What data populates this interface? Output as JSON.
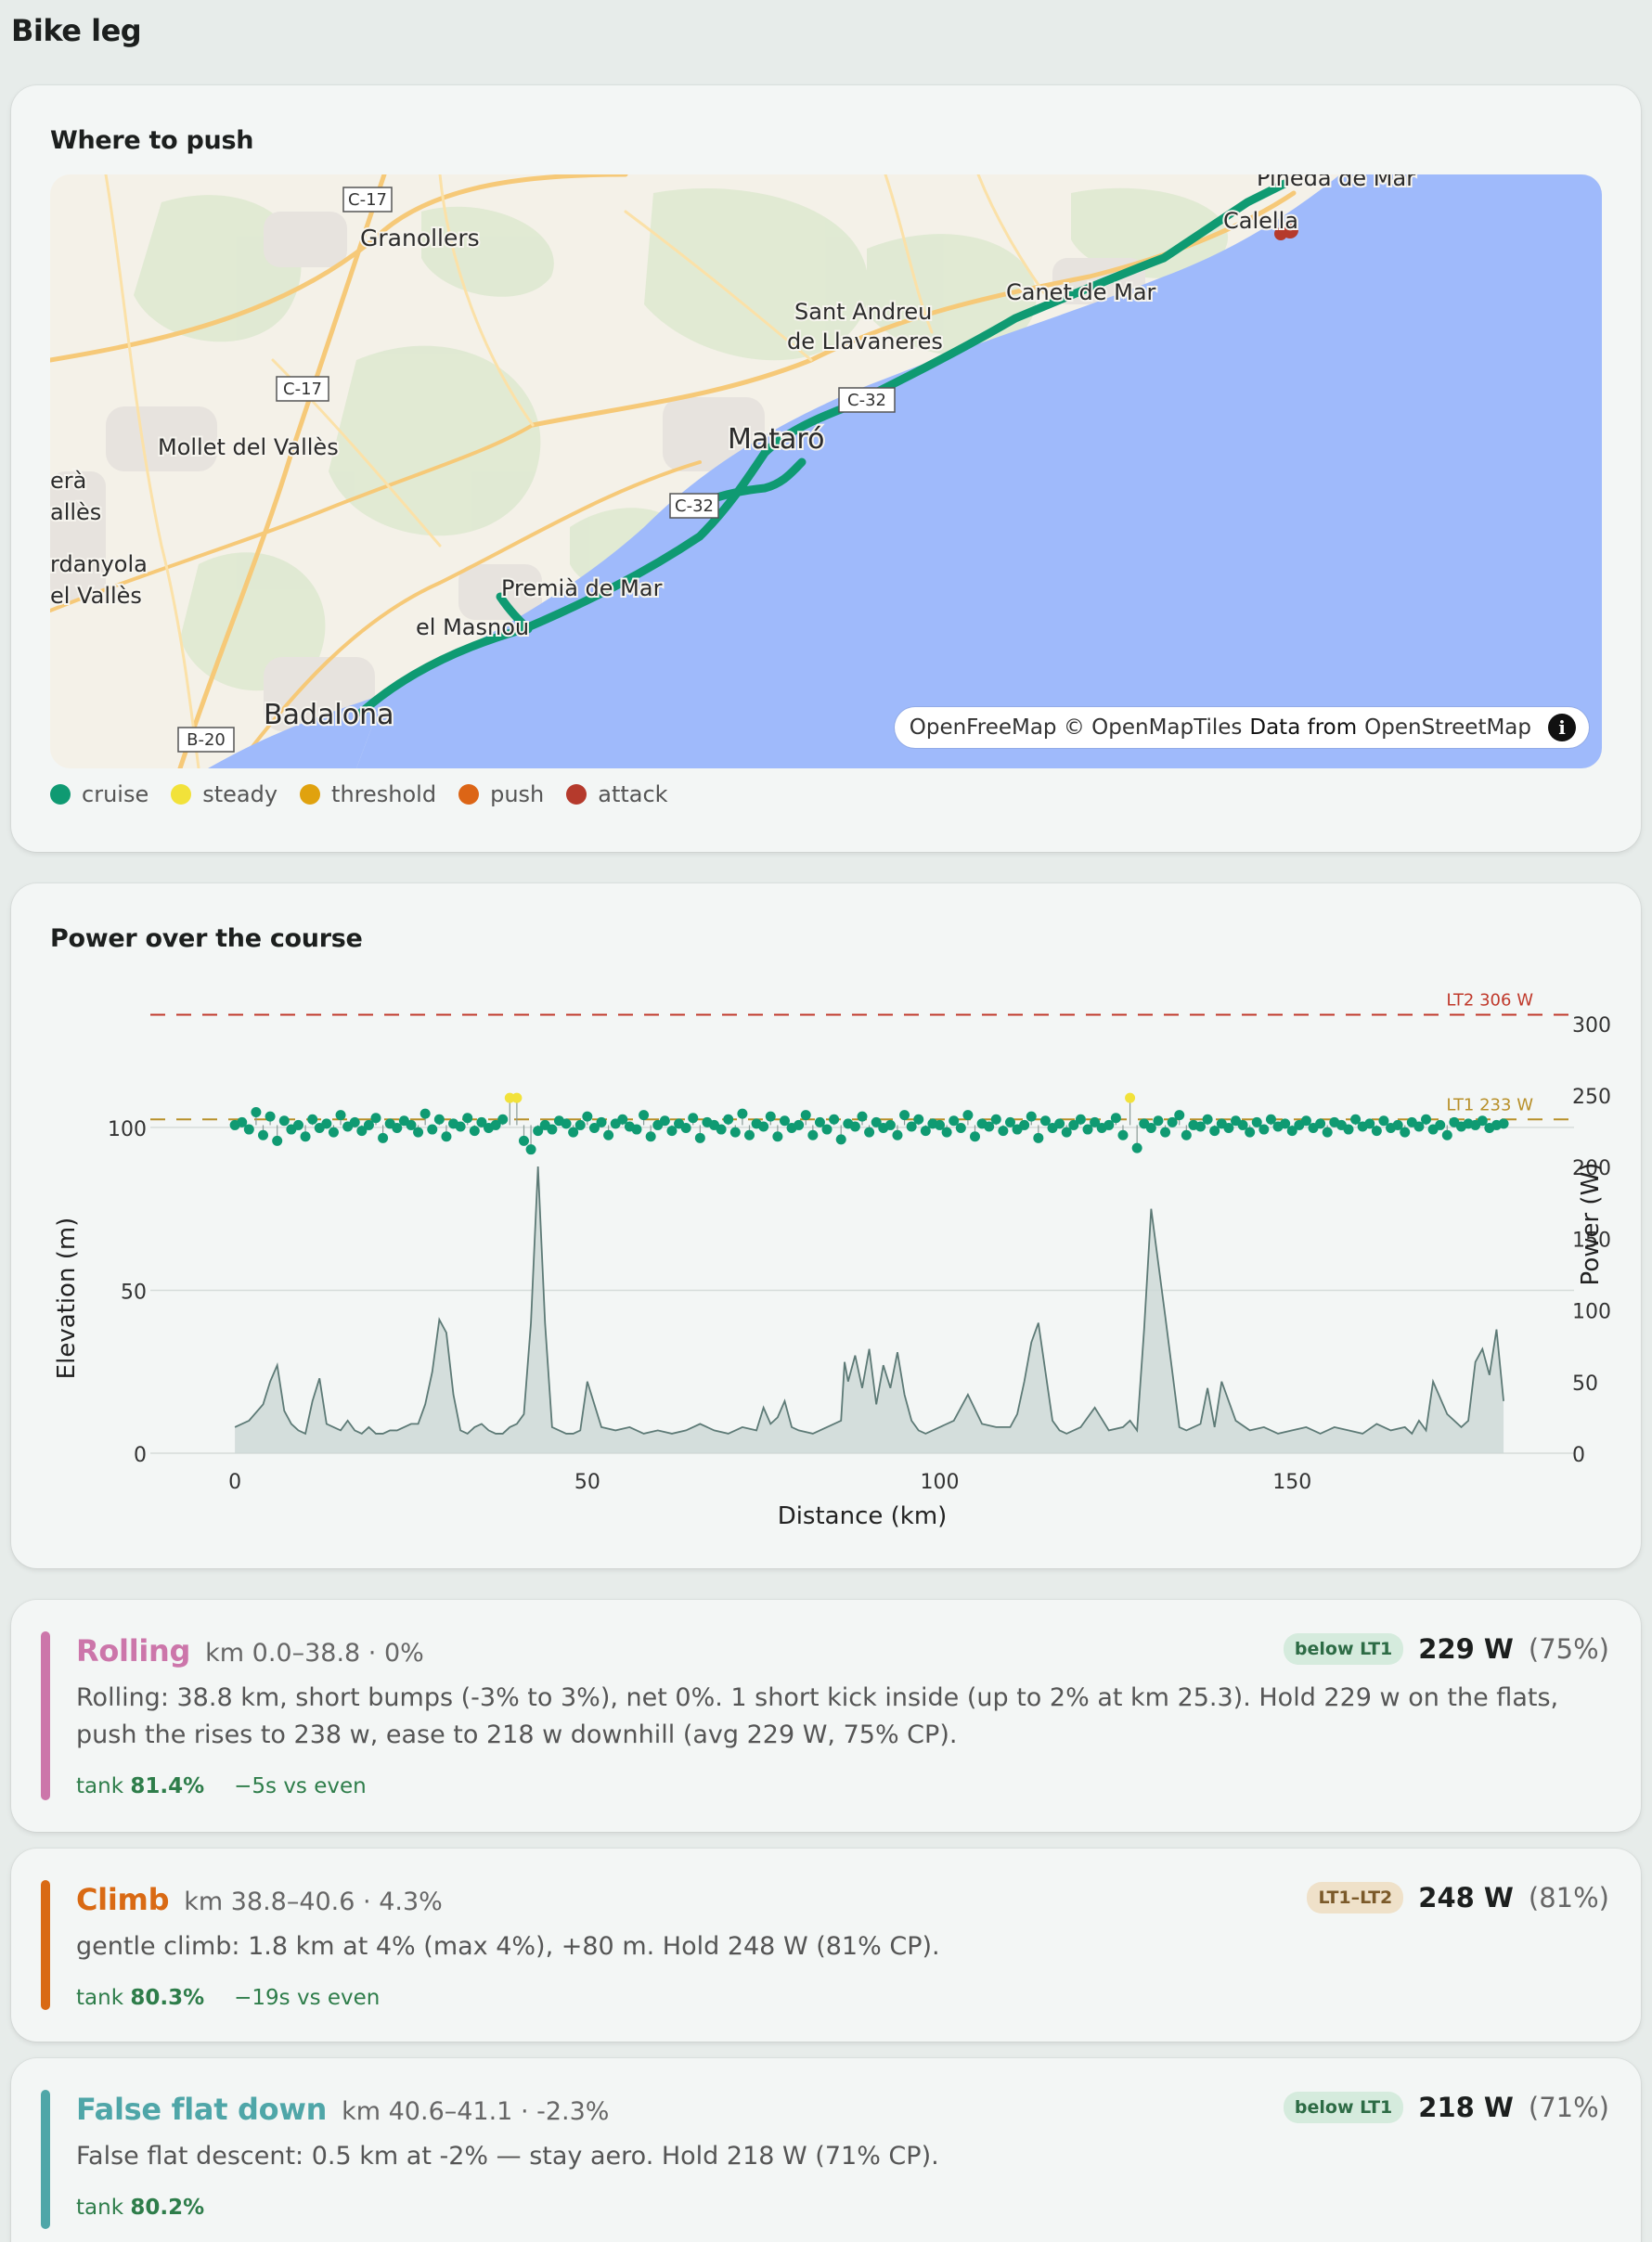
{
  "page": {
    "title": "Bike leg"
  },
  "map_card": {
    "title": "Where to push",
    "places": [
      "Pineda de Mar",
      "Calella",
      "Granollers",
      "Canet de Mar",
      "Sant Andreu",
      "de Llavaneres",
      "Mataró",
      "Mollet del Vallès",
      "erà",
      "allès",
      "rdanyola",
      "el Vallès",
      "Premià de Mar",
      "el Masnou",
      "Badalona"
    ],
    "roads": [
      "C-17",
      "C-17",
      "C-32",
      "C-32",
      "B-20"
    ],
    "attribution": {
      "part1": "OpenFreeMap © OpenMapTiles",
      "part2": "Data from",
      "part3": "OpenStreetMap",
      "info": "i"
    },
    "legend": [
      {
        "label": "cruise",
        "color": "#0f9a72"
      },
      {
        "label": "steady",
        "color": "#f2e23a"
      },
      {
        "label": "threshold",
        "color": "#e0a20e"
      },
      {
        "label": "push",
        "color": "#dc6516"
      },
      {
        "label": "attack",
        "color": "#b53a2c"
      }
    ]
  },
  "power_card": {
    "title": "Power over the course",
    "chart_data": {
      "type": "line",
      "xlabel": "Distance (km)",
      "ylabel_left": "Elevation (m)",
      "ylabel_right": "Power (W)",
      "x_ticks": [
        "0",
        "50",
        "100",
        "150"
      ],
      "y_left_ticks": [
        "0",
        "50",
        "100"
      ],
      "y_right_ticks": [
        "0",
        "50",
        "100",
        "150",
        "200",
        "250",
        "300"
      ],
      "xlim": [
        -12,
        190
      ],
      "ylim_left": [
        0,
        135
      ],
      "ylim_right": [
        0,
        307
      ],
      "thresholds": [
        {
          "label": "LT2 306 W",
          "value": 306,
          "color": "#c0392b"
        },
        {
          "label": "LT1 233 W",
          "value": 233,
          "color": "#b8902a"
        }
      ],
      "elevation": {
        "x": [
          0,
          2,
          4,
          5,
          6,
          7,
          8,
          9,
          10,
          11,
          12,
          13,
          14,
          15,
          16,
          17,
          18,
          19,
          20,
          21,
          22,
          23,
          24,
          25,
          26,
          27,
          28,
          29,
          30,
          31,
          32,
          33,
          34,
          35,
          36,
          37,
          38,
          39,
          40,
          41,
          42,
          43,
          44,
          45,
          46,
          47,
          48,
          49,
          50,
          52,
          54,
          56,
          58,
          60,
          62,
          64,
          66,
          68,
          70,
          72,
          74,
          75,
          76,
          77,
          78,
          79,
          80,
          82,
          84,
          86,
          86.5,
          87,
          88,
          89,
          90,
          91,
          92,
          93,
          94,
          95,
          96,
          97,
          98,
          100,
          102,
          104,
          106,
          108,
          110,
          111,
          112,
          113,
          114,
          115,
          116,
          117,
          118,
          120,
          122,
          124,
          126,
          127,
          128,
          129,
          130,
          132,
          134,
          135,
          136,
          137,
          138,
          139,
          140,
          142,
          144,
          146,
          148,
          150,
          152,
          154,
          156,
          158,
          160,
          162,
          164,
          166,
          167,
          168,
          169,
          170,
          172,
          174,
          175,
          176,
          177,
          178,
          179,
          180
        ],
        "y": [
          8,
          10,
          15,
          22,
          27,
          13,
          9,
          7,
          6,
          16,
          23,
          9,
          8,
          7,
          10,
          7,
          6,
          8,
          6,
          6,
          7,
          7,
          8,
          9,
          9,
          15,
          25,
          41,
          37,
          18,
          7,
          6,
          8,
          9,
          7,
          6,
          6,
          8,
          9,
          12,
          40,
          88,
          40,
          8,
          7,
          6,
          6,
          7,
          22,
          8,
          7,
          8,
          6,
          7,
          6,
          7,
          9,
          7,
          6,
          8,
          7,
          14,
          9,
          11,
          16,
          8,
          7,
          6,
          8,
          10,
          28,
          22,
          30,
          20,
          32,
          15,
          27,
          20,
          31,
          18,
          10,
          7,
          6,
          8,
          10,
          18,
          9,
          8,
          8,
          12,
          22,
          34,
          40,
          25,
          10,
          7,
          6,
          8,
          14,
          7,
          8,
          10,
          7,
          38,
          75,
          42,
          8,
          7,
          8,
          9,
          20,
          8,
          22,
          10,
          7,
          8,
          6,
          7,
          8,
          6,
          8,
          7,
          6,
          9,
          7,
          8,
          6,
          10,
          7,
          22,
          12,
          8,
          10,
          28,
          32,
          24,
          38,
          16,
          9,
          8
        ]
      },
      "power": {
        "x": [
          0,
          1,
          2,
          3,
          4,
          5,
          6,
          7,
          8,
          9,
          10,
          11,
          12,
          13,
          14,
          15,
          16,
          17,
          18,
          19,
          20,
          21,
          22,
          23,
          24,
          25,
          26,
          27,
          28,
          29,
          30,
          31,
          32,
          33,
          34,
          35,
          36,
          37,
          38,
          39,
          40,
          41,
          42,
          43,
          44,
          45,
          46,
          47,
          48,
          49,
          50,
          51,
          52,
          53,
          54,
          55,
          56,
          57,
          58,
          59,
          60,
          61,
          62,
          63,
          64,
          65,
          66,
          67,
          68,
          69,
          70,
          71,
          72,
          73,
          74,
          75,
          76,
          77,
          78,
          79,
          80,
          81,
          82,
          83,
          84,
          85,
          86,
          87,
          88,
          89,
          90,
          91,
          92,
          93,
          94,
          95,
          96,
          97,
          98,
          99,
          100,
          101,
          102,
          103,
          104,
          105,
          106,
          107,
          108,
          109,
          110,
          111,
          112,
          113,
          114,
          115,
          116,
          117,
          118,
          119,
          120,
          121,
          122,
          123,
          124,
          125,
          126,
          127,
          128,
          129,
          130,
          131,
          132,
          133,
          134,
          135,
          136,
          137,
          138,
          139,
          140,
          141,
          142,
          143,
          144,
          145,
          146,
          147,
          148,
          149,
          150,
          151,
          152,
          153,
          154,
          155,
          156,
          157,
          158,
          159,
          160,
          161,
          162,
          163,
          164,
          165,
          166,
          167,
          168,
          169,
          170,
          171,
          172,
          173,
          174,
          175,
          176,
          177,
          178,
          179,
          180
        ],
        "y": [
          229,
          231,
          226,
          238,
          222,
          235,
          218,
          232,
          226,
          229,
          221,
          233,
          227,
          230,
          224,
          236,
          228,
          231,
          225,
          229,
          234,
          220,
          230,
          227,
          232,
          229,
          224,
          237,
          226,
          233,
          221,
          230,
          228,
          234,
          225,
          231,
          227,
          229,
          233,
          248,
          248,
          218,
          212,
          225,
          229,
          226,
          232,
          230,
          224,
          229,
          235,
          227,
          231,
          222,
          230,
          233,
          228,
          226,
          236,
          221,
          229,
          232,
          225,
          230,
          227,
          234,
          220,
          231,
          229,
          226,
          233,
          224,
          237,
          222,
          230,
          228,
          235,
          221,
          232,
          227,
          229,
          236,
          222,
          231,
          226,
          233,
          219,
          230,
          228,
          235,
          224,
          231,
          227,
          229,
          222,
          236,
          228,
          233,
          225,
          230,
          229,
          224,
          232,
          227,
          236,
          221,
          230,
          228,
          233,
          225,
          231,
          226,
          229,
          235,
          220,
          232,
          227,
          230,
          224,
          229,
          233,
          226,
          231,
          227,
          229,
          234,
          222,
          248,
          213,
          230,
          227,
          232,
          224,
          231,
          236,
          222,
          229,
          228,
          233,
          225,
          230,
          227,
          232,
          229,
          224,
          231,
          226,
          233,
          228,
          230,
          225,
          229,
          232,
          227,
          230,
          224,
          231,
          229,
          226,
          233,
          228,
          230,
          225,
          232,
          227,
          229,
          224,
          231,
          228,
          233,
          226,
          229,
          222,
          231,
          228,
          230,
          229,
          232,
          227,
          229,
          230
        ]
      }
    }
  },
  "segments": [
    {
      "name": "Rolling",
      "meta": "km 0.0–38.8 · 0%",
      "color": "#cc76aa",
      "badge": "below LT1",
      "power": "229 W",
      "pct": "(75%)",
      "desc": "Rolling: 38.8 km, short bumps (-3% to 3%), net 0%. 1 short kick inside (up to 2% at km 25.3). Hold 229 w on the flats, push the rises to 238 w, ease to 218 w downhill (avg 229 W, 75% CP).",
      "tank_label": "tank",
      "tank": "81.4%",
      "delta": "−5s vs even"
    },
    {
      "name": "Climb",
      "meta": "km 38.8–40.6 · 4.3%",
      "color": "#d96a14",
      "badge": "LT1–LT2",
      "power": "248 W",
      "pct": "(81%)",
      "desc": "gentle climb: 1.8 km at 4% (max 4%), +80 m. Hold 248 W (81% CP).",
      "tank_label": "tank",
      "tank": "80.3%",
      "delta": "−19s vs even"
    },
    {
      "name": "False flat down",
      "meta": "km 40.6–41.1 · -2.3%",
      "color": "#4fa6a8",
      "badge": "below LT1",
      "power": "218 W",
      "pct": "(71%)",
      "desc": "False flat descent: 0.5 km at -2% — stay aero. Hold 218 W (71% CP).",
      "tank_label": "tank",
      "tank": "80.2%",
      "delta": ""
    }
  ]
}
